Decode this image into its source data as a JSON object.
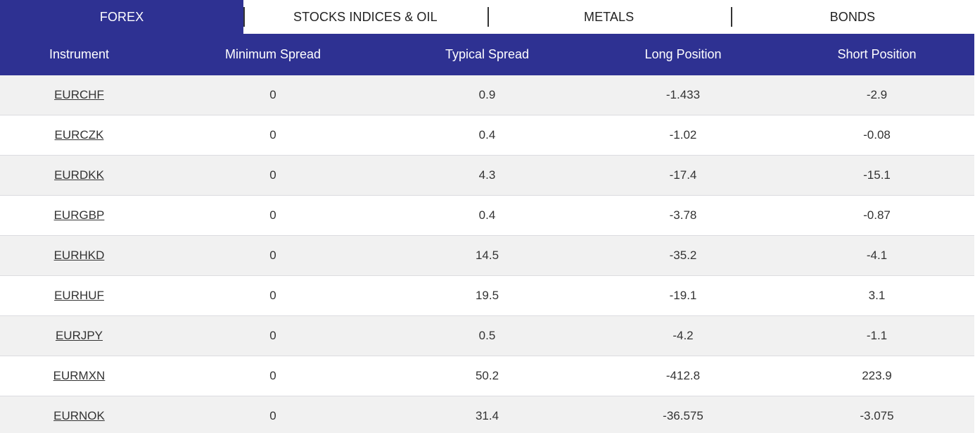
{
  "colors": {
    "brand": "#2e3192",
    "row_alt": "#f1f1f1",
    "row_plain": "#ffffff"
  },
  "tabs": [
    {
      "label": "FOREX",
      "active": true
    },
    {
      "label": "STOCKS INDICES & OIL",
      "active": false
    },
    {
      "label": "METALS",
      "active": false
    },
    {
      "label": "BONDS",
      "active": false
    }
  ],
  "table": {
    "headers": [
      "Instrument",
      "Minimum Spread",
      "Typical Spread",
      "Long Position",
      "Short Position"
    ],
    "rows": [
      {
        "instrument": "EURCHF",
        "min_spread": "0",
        "typical_spread": "0.9",
        "long": "-1.433",
        "short": "-2.9"
      },
      {
        "instrument": "EURCZK",
        "min_spread": "0",
        "typical_spread": "0.4",
        "long": "-1.02",
        "short": "-0.08"
      },
      {
        "instrument": "EURDKK",
        "min_spread": "0",
        "typical_spread": "4.3",
        "long": "-17.4",
        "short": "-15.1"
      },
      {
        "instrument": "EURGBP",
        "min_spread": "0",
        "typical_spread": "0.4",
        "long": "-3.78",
        "short": "-0.87"
      },
      {
        "instrument": "EURHKD",
        "min_spread": "0",
        "typical_spread": "14.5",
        "long": "-35.2",
        "short": "-4.1"
      },
      {
        "instrument": "EURHUF",
        "min_spread": "0",
        "typical_spread": "19.5",
        "long": "-19.1",
        "short": "3.1"
      },
      {
        "instrument": "EURJPY",
        "min_spread": "0",
        "typical_spread": "0.5",
        "long": "-4.2",
        "short": "-1.1"
      },
      {
        "instrument": "EURMXN",
        "min_spread": "0",
        "typical_spread": "50.2",
        "long": "-412.8",
        "short": "223.9"
      },
      {
        "instrument": "EURNOK",
        "min_spread": "0",
        "typical_spread": "31.4",
        "long": "-36.575",
        "short": "-3.075"
      }
    ]
  }
}
